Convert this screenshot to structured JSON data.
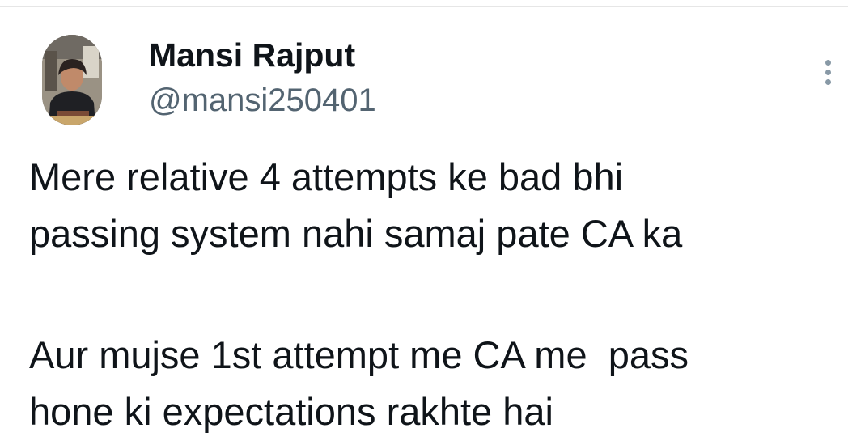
{
  "tweet": {
    "author": {
      "display_name": "Mansi Rajput",
      "handle": "@mansi250401",
      "avatar_icon": "profile-photo"
    },
    "more_icon": "more-vertical-icon",
    "text": {
      "paragraph_1": [
        "Mere relative 4 attempts ke bad bhi",
        "passing system nahi samaj pate CA ka"
      ],
      "paragraph_2": [
        "Aur mujse 1st attempt me CA me  pass",
        "hone ki expectations rakhte hai"
      ]
    }
  },
  "colors": {
    "text_primary": "#0f1419",
    "text_secondary": "#536471",
    "icon_gray": "#8899a6",
    "background": "#ffffff"
  }
}
